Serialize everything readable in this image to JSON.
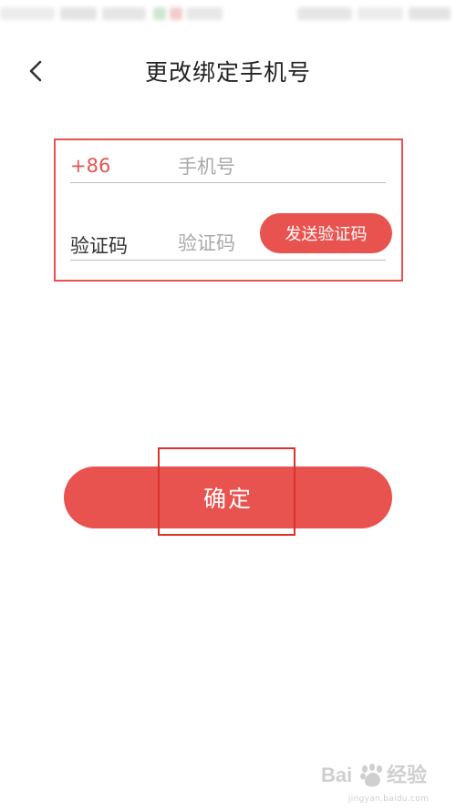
{
  "header": {
    "title": "更改绑定手机号",
    "back_icon": "chevron-left-icon"
  },
  "form": {
    "country_code": "+86",
    "phone_placeholder": "手机号",
    "phone_value": "",
    "code_label": "验证码",
    "code_placeholder": "验证码",
    "code_value": "",
    "send_code_label": "发送验证码"
  },
  "confirm": {
    "label": "确定"
  },
  "colors": {
    "accent": "#e8534f",
    "highlight_border": "#d8322d",
    "country_code": "#e55450",
    "placeholder": "#a8a8a8",
    "divider": "#bdbdbd"
  },
  "watermark": {
    "logo": "Bai du 经验",
    "url": "jingyan.baidu.com"
  }
}
